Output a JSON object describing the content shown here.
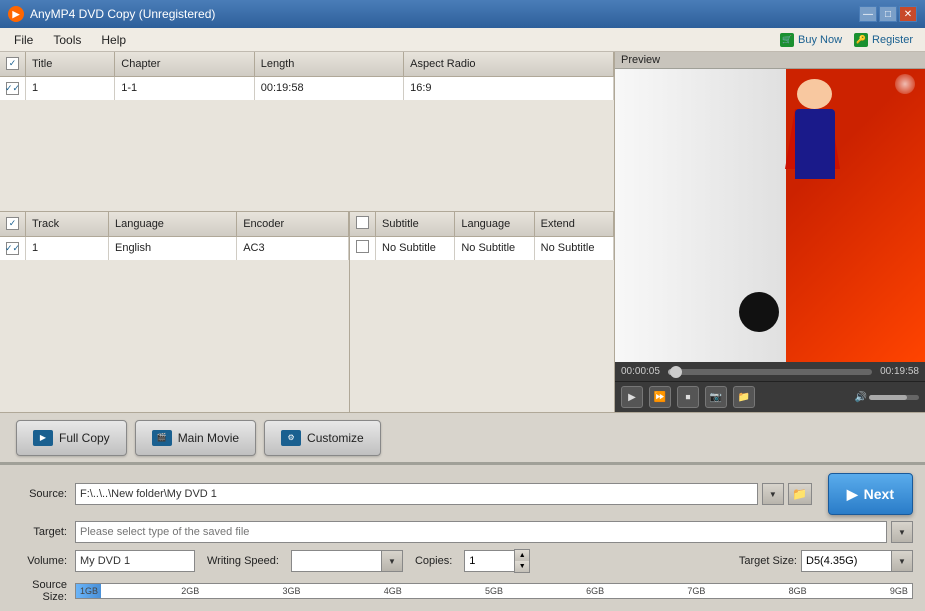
{
  "titleBar": {
    "appName": "AnyMP4 DVD Copy (Unregistered)",
    "minimize": "—",
    "maximize": "□",
    "close": "✕"
  },
  "menuBar": {
    "items": [
      "File",
      "Tools",
      "Help"
    ],
    "buyLabel": "Buy Now",
    "registerLabel": "Register"
  },
  "videoTable": {
    "headers": [
      "",
      "Title",
      "Chapter",
      "Length",
      "Aspect Radio"
    ],
    "rows": [
      {
        "checked": true,
        "title": "1",
        "chapter": "1-1",
        "length": "00:19:58",
        "aspect": "16:9"
      }
    ]
  },
  "audioTable": {
    "headers": [
      "",
      "Track",
      "Language",
      "Encoder"
    ],
    "rows": [
      {
        "checked": true,
        "track": "1",
        "language": "English",
        "encoder": "AC3"
      }
    ]
  },
  "subtitleTable": {
    "headers": [
      "",
      "Subtitle",
      "Language",
      "Extend"
    ],
    "rows": [
      {
        "checked": false,
        "subtitle": "No Subtitle",
        "language": "No Subtitle",
        "extend": "No Subtitle"
      }
    ]
  },
  "preview": {
    "label": "Preview",
    "timeStart": "00:00:05",
    "timeEnd": "00:19:58"
  },
  "actionButtons": {
    "fullCopy": "Full Copy",
    "mainMovie": "Main Movie",
    "customize": "Customize"
  },
  "config": {
    "sourceLabel": "Source:",
    "sourceValue": "F:\\..\\..\\New folder\\My DVD 1",
    "sourcePlaceholder": "F:\\..\\..\\New folder\\My DVD 1",
    "targetLabel": "Target:",
    "targetValue": "",
    "targetPlaceholder": "Please select type of the saved file",
    "volumeLabel": "Volume:",
    "volumeValue": "My DVD 1",
    "writingSpeedLabel": "Writing Speed:",
    "writingSpeedValue": "",
    "copiesLabel": "Copies:",
    "copiesValue": "1",
    "targetSizeLabel": "Target Size:",
    "targetSizeValue": "D5(4.35G)",
    "sourceSizeLabel": "Source Size:",
    "nextButton": "Next"
  },
  "sizeBarLabels": [
    "1GB",
    "2GB",
    "3GB",
    "4GB",
    "5GB",
    "6GB",
    "7GB",
    "8GB",
    "9GB"
  ]
}
